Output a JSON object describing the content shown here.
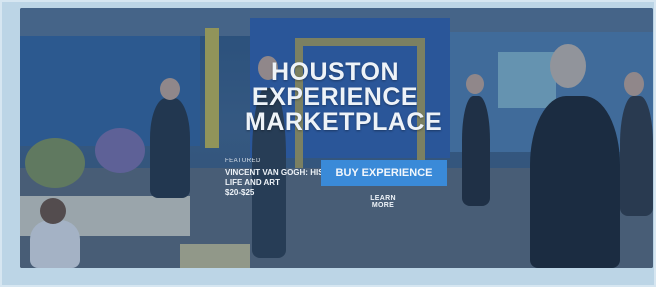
{
  "hero": {
    "title": "HOUSTON EXPERIENCE MARKETPLACE",
    "featured": {
      "label": "FEATURED",
      "title": "VINCENT VAN GOGH: HIS LIFE AND ART",
      "price": "$20-$25"
    },
    "cta_label": "BUY EXPERIENCE",
    "learn_more_label": "LEARN MORE"
  },
  "colors": {
    "frame_background": "#bcd5e6",
    "overlay": "#2c5082",
    "cta_button": "#3a8ad8",
    "text": "#eef3f8"
  }
}
